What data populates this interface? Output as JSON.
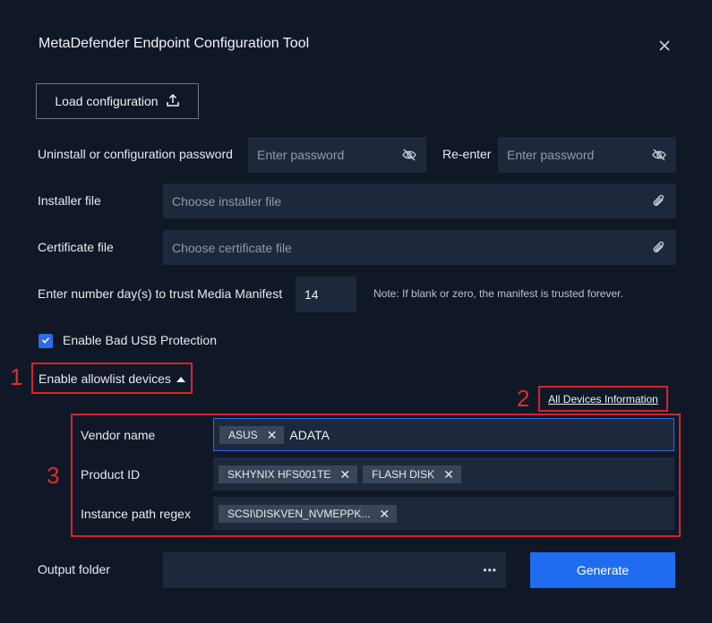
{
  "window": {
    "title": "MetaDefender Endpoint Configuration Tool"
  },
  "load": {
    "label": "Load configuration"
  },
  "password": {
    "label": "Uninstall or configuration password",
    "placeholder": "Enter password",
    "reenter_label": "Re-enter",
    "reenter_placeholder": "Enter password"
  },
  "installer": {
    "label": "Installer file",
    "placeholder": "Choose installer file"
  },
  "certificate": {
    "label": "Certificate file",
    "placeholder": "Choose certificate file"
  },
  "manifest": {
    "label": "Enter number day(s) to trust Media Manifest",
    "value": "14",
    "note": "Note: If blank or zero, the manifest is trusted forever."
  },
  "bad_usb": {
    "label": "Enable Bad USB Protection",
    "checked": true
  },
  "allowlist": {
    "label": "Enable allowlist devices",
    "all_devices_link": "All Devices Information",
    "vendor": {
      "label": "Vendor name",
      "tags": [
        "ASUS"
      ],
      "input_value": "ADATA"
    },
    "product": {
      "label": "Product ID",
      "tags": [
        "SKHYNIX HFS001TE",
        "FLASH DISK"
      ]
    },
    "instance": {
      "label": "Instance path regex",
      "tags": [
        "SCSI\\DISKVEN_NVMEPPK..."
      ]
    }
  },
  "output": {
    "label": "Output folder",
    "more": "•••"
  },
  "generate": {
    "label": "Generate"
  },
  "annotations": {
    "n1": "1",
    "n2": "2",
    "n3": "3"
  },
  "colors": {
    "accent": "#1f6cf0",
    "highlight": "#d6222a",
    "background": "#101827"
  },
  "icons": {
    "close": "close-icon",
    "upload": "upload-icon",
    "eye": "eye-off-icon",
    "clip": "paperclip-icon",
    "caret": "caret-up-icon",
    "check": "check-icon",
    "tag_remove": "close-icon"
  }
}
